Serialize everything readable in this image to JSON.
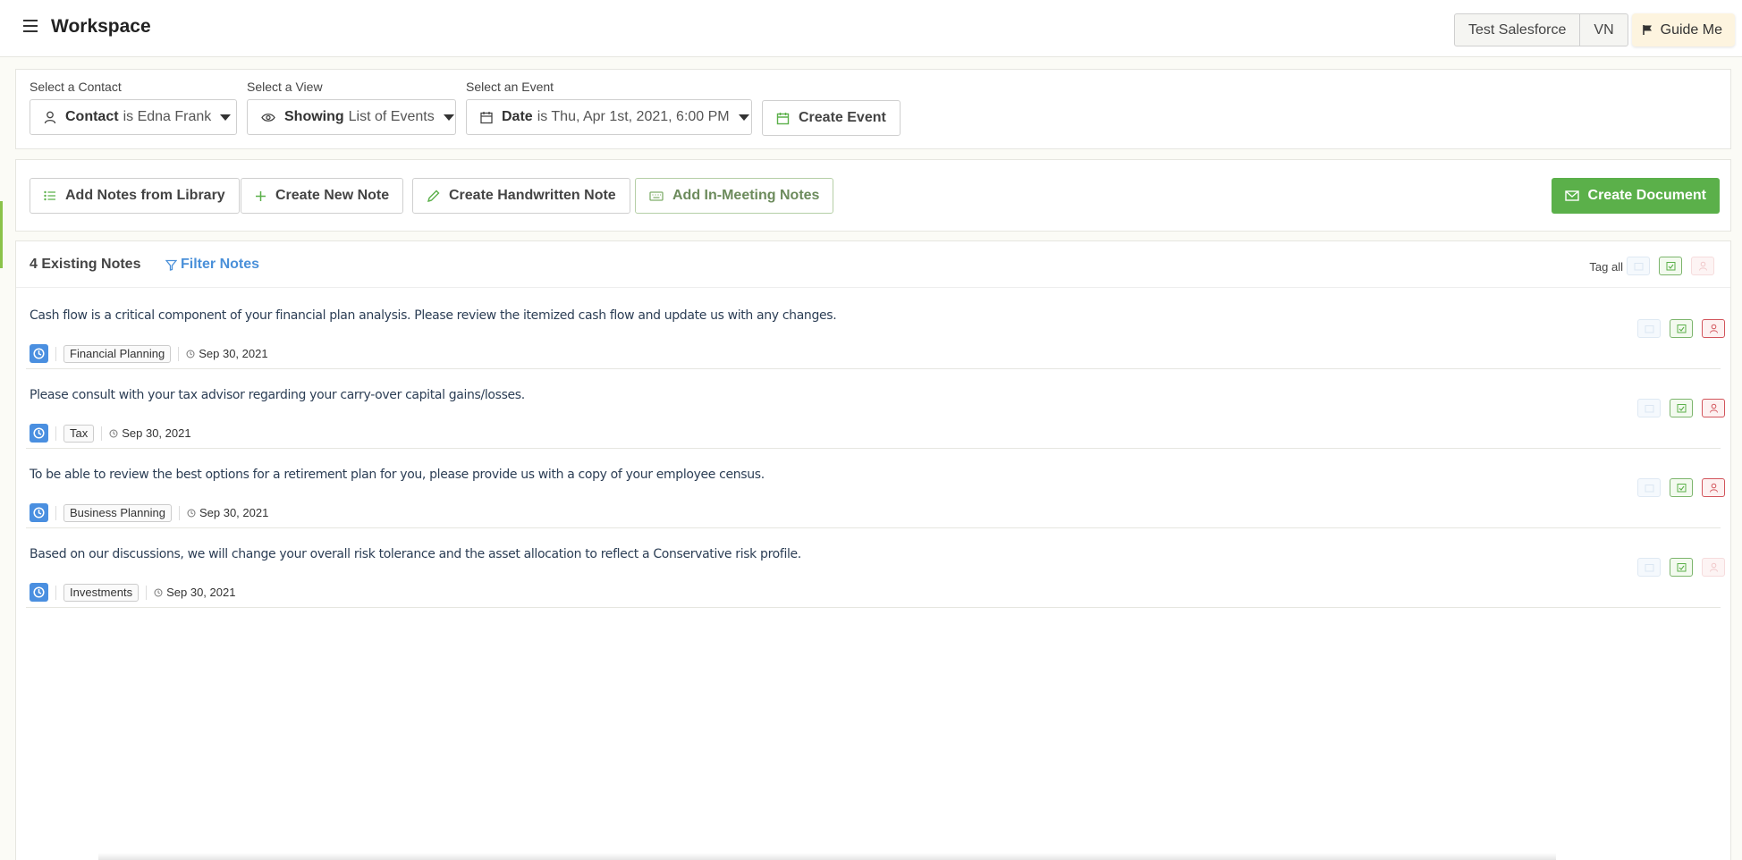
{
  "header": {
    "title": "Workspace",
    "crm_label": "Test Salesforce",
    "user_initials": "VN",
    "guide_label": "Guide Me"
  },
  "selectors": {
    "contact": {
      "label": "Select a Contact",
      "key": "Contact",
      "value": "is Edna Frank"
    },
    "view": {
      "label": "Select a View",
      "key": "Showing",
      "value": "List of Events"
    },
    "event": {
      "label": "Select an Event",
      "key": "Date",
      "value": "is Thu, Apr 1st, 2021, 6:00 PM"
    },
    "create_event_label": "Create Event"
  },
  "actions": {
    "add_library": "Add Notes from Library",
    "create_new": "Create New Note",
    "create_handwritten": "Create Handwritten Note",
    "add_in_meeting": "Add In-Meeting Notes",
    "create_document": "Create Document"
  },
  "notes_panel": {
    "count_label": "4 Existing Notes",
    "filter_label": "Filter Notes",
    "tag_all_label": "Tag all"
  },
  "notes": [
    {
      "text": "Cash flow is a critical component of your financial plan analysis. Please review the itemized cash flow and update us with any changes.",
      "tag": "Financial Planning",
      "date": "Sep 30, 2021",
      "person_tag_active": true
    },
    {
      "text": "Please consult with your tax advisor regarding your carry-over capital gains/losses.",
      "tag": "Tax",
      "date": "Sep 30, 2021",
      "person_tag_active": true
    },
    {
      "text": "To be able to review the best options for a retirement plan for you, please provide us with a copy of your employee census.",
      "tag": "Business Planning",
      "date": "Sep 30, 2021",
      "person_tag_active": true
    },
    {
      "text": "Based on our discussions, we will change your overall risk tolerance and the asset allocation to reflect a Conservative risk profile.",
      "tag": "Investments",
      "date": "Sep 30, 2021",
      "person_tag_active": false
    }
  ],
  "colors": {
    "accent_green": "#5bb04a",
    "link_blue": "#4a90d9",
    "clock_blue": "#4a8fe0",
    "tag_red": "#d2545b"
  },
  "icons": {
    "menu": "hamburger-icon",
    "guide": "flag-icon",
    "contact": "user-icon",
    "view": "eye-icon",
    "event": "calendar-icon",
    "library": "list-icon",
    "new_note": "plus-icon",
    "handwritten": "pen-icon",
    "in_meeting": "keyboard-icon",
    "document": "envelope-icon",
    "filter": "funnel-icon",
    "note_badge": "clock-icon"
  }
}
